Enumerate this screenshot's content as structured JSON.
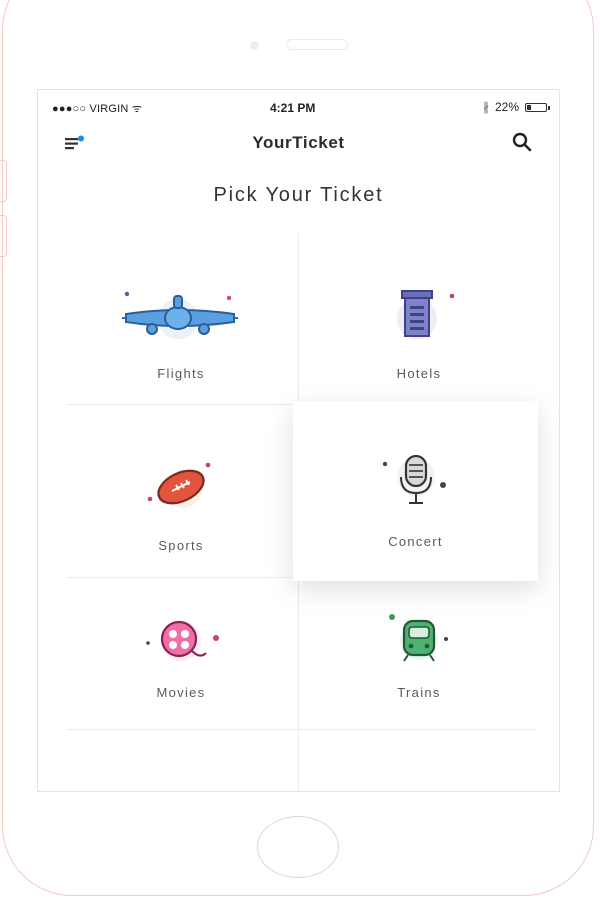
{
  "status_bar": {
    "carrier": "●●●○○ VIRGIN ᯤ",
    "time": "4:21 PM",
    "bluetooth": "∦",
    "battery_text": "22%",
    "battery_level": 0.22
  },
  "header": {
    "title": "YourTicket",
    "menu_icon": "hamburger-menu-icon",
    "search_icon": "search-icon",
    "notification_color": "#1e88e5"
  },
  "page": {
    "title": "Pick Your Ticket"
  },
  "categories": [
    {
      "label": "Flights",
      "icon": "airplane-icon"
    },
    {
      "label": "Hotels",
      "icon": "hotel-icon"
    },
    {
      "label": "Sports",
      "icon": "football-icon"
    },
    {
      "label": "Concert",
      "icon": "microphone-icon",
      "selected": true
    },
    {
      "label": "Movies",
      "icon": "film-reel-icon"
    },
    {
      "label": "Trains",
      "icon": "train-icon"
    }
  ],
  "colors": {
    "flight": "#3f8fd6",
    "hotel": "#6b6fb8",
    "sports": "#e2543b",
    "concert": "#555555",
    "movies": "#e0458b",
    "trains": "#3e9a5c",
    "frame": "#f6c9c3"
  }
}
